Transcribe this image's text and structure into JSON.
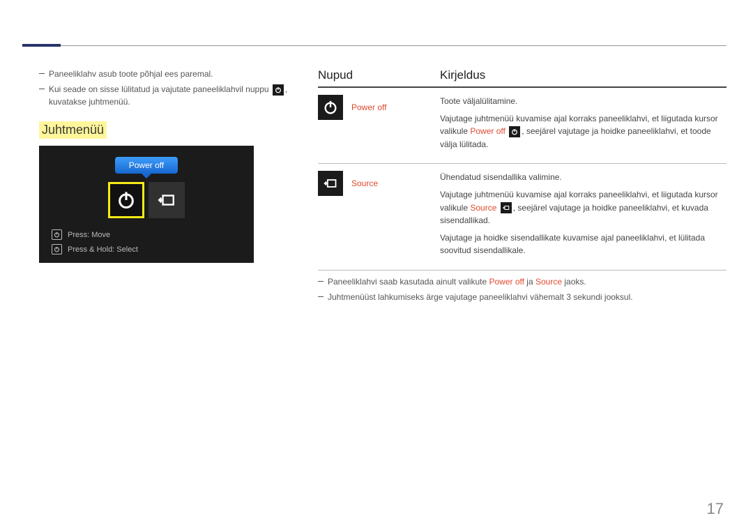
{
  "intro": {
    "n1": "Paneeliklahv asub toote põhjal ees paremal.",
    "n2a": "Kui seade on sisse lülitatud ja vajutate paneeliklahvil nuppu",
    "n2b": ", kuvatakse juhtmenüü."
  },
  "section_title": "Juhtmenüü",
  "menu": {
    "bubble": "Power off",
    "hint1": "Press: Move",
    "hint2": "Press & Hold: Select"
  },
  "table": {
    "h1": "Nupud",
    "h2": "Kirjeldus",
    "r1": {
      "label": "Power off",
      "d1": "Toote väljalülitamine.",
      "d2a": "Vajutage juhtmenüü kuvamise ajal korraks paneeliklahvi, et liigutada kursor valikule ",
      "d2a_red": "Power off",
      "d2b": ", seejärel vajutage ja hoidke paneeliklahvi, et toode välja lülitada."
    },
    "r2": {
      "label": "Source",
      "d1": "Ühendatud sisendallika valimine.",
      "d2a": "Vajutage juhtmenüü kuvamise ajal korraks paneeliklahvi, et liigutada kursor valikule ",
      "d2a_red": "Source",
      "d2b": ", seejärel vajutage ja hoidke paneeliklahvi, et kuvada sisendallikad.",
      "d3": "Vajutage ja hoidke sisendallikate kuvamise ajal paneeliklahvi, et lülitada soovitud sisendallikale."
    }
  },
  "foot": {
    "f1a": "Paneeliklahvi saab kasutada ainult valikute ",
    "f1_red1": "Power off",
    "f1b": " ja ",
    "f1_red2": "Source",
    "f1c": " jaoks.",
    "f2": "Juhtmenüüst lahkumiseks ärge vajutage paneeliklahvi vähemalt 3 sekundi jooksul."
  },
  "page": "17"
}
